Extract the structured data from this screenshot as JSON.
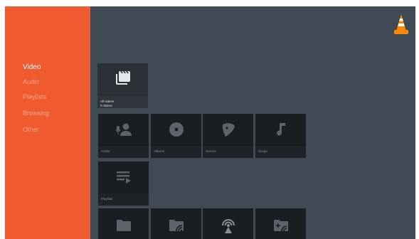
{
  "sidebar": {
    "items": [
      {
        "label": "Video",
        "active": true
      },
      {
        "label": "Audio",
        "active": false
      },
      {
        "label": "Playlists",
        "active": false
      },
      {
        "label": "Browsing",
        "active": false
      },
      {
        "label": "Other",
        "active": false
      }
    ]
  },
  "logo": {
    "icon": "vlc-cone-icon"
  },
  "video_section": {
    "all_videos": {
      "line1": "All videos",
      "line2": "0 videos"
    }
  },
  "audio_section": {
    "artists": "Artists",
    "albums": "Albums",
    "genres": "Genres",
    "songs": "Songs"
  },
  "playlists_section": {
    "playlists": "Playlists"
  },
  "browsing_section": {
    "icons": [
      "folder-icon",
      "network-folder-icon",
      "stream-icon",
      "add-network-folder-icon"
    ]
  },
  "colors": {
    "sidebar": "#ef5a2f",
    "background": "#404a55",
    "card": "#1a1d21",
    "accent": "#ff8800"
  }
}
